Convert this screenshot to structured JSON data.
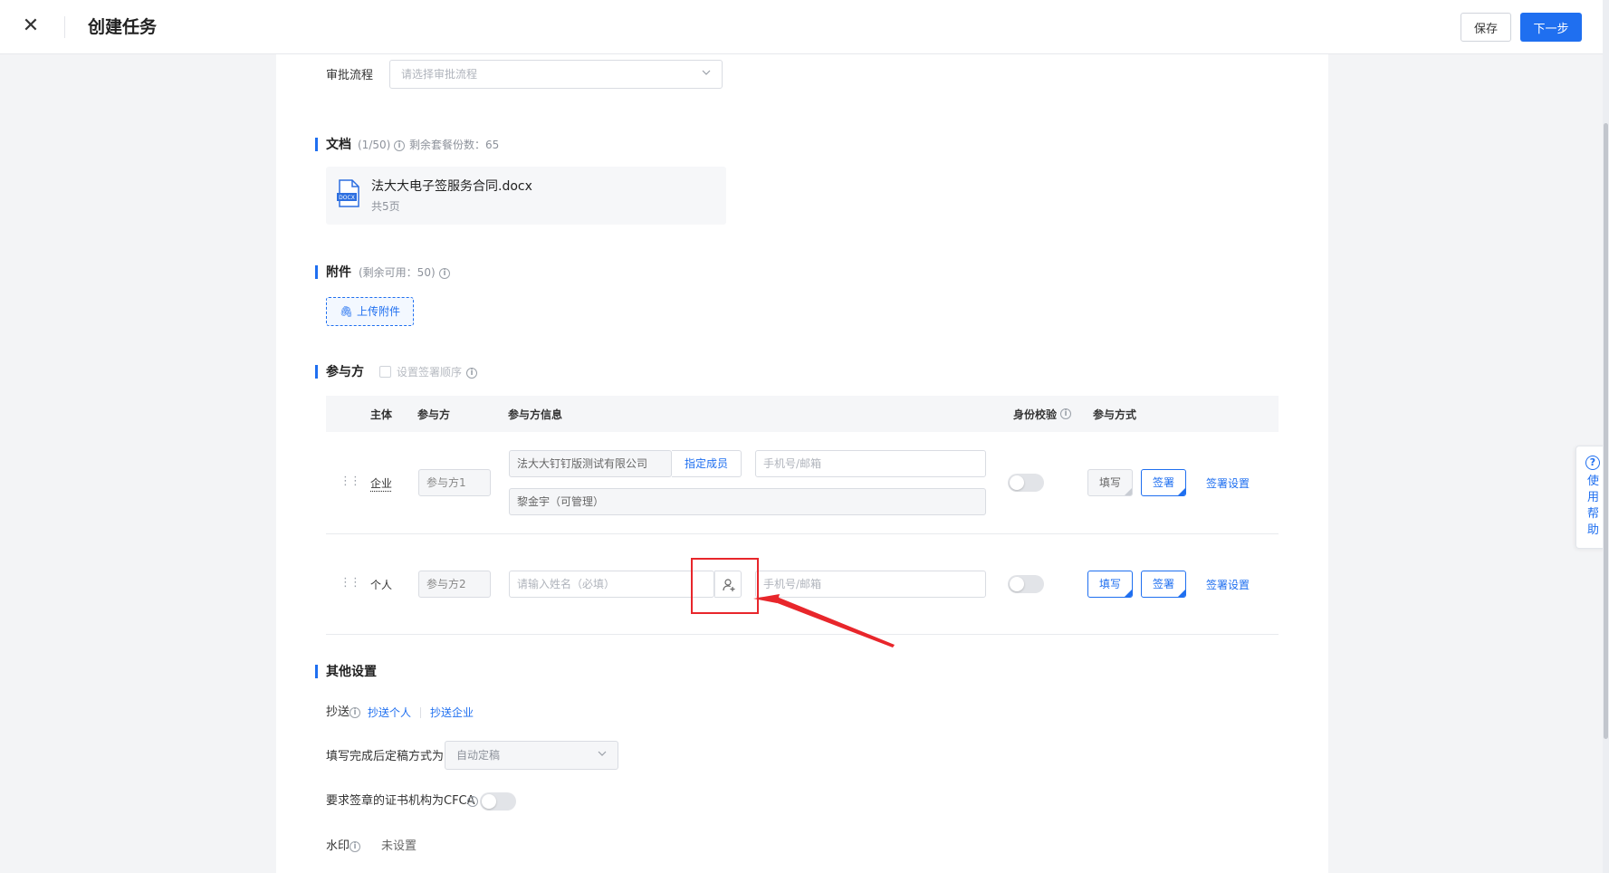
{
  "header": {
    "title": "创建任务",
    "save_label": "保存",
    "next_label": "下一步"
  },
  "approval": {
    "label": "审批流程",
    "placeholder": "请选择审批流程"
  },
  "documents": {
    "title": "文档",
    "count": "(1/50)",
    "remaining": "剩余套餐份数：65",
    "file_name": "法大大电子签服务合同.docx",
    "file_pages": "共5页",
    "file_icon_text": "DOCX"
  },
  "attachments": {
    "title": "附件",
    "available": "(剩余可用：50)",
    "upload_label": "上传附件"
  },
  "participants": {
    "title": "参与方",
    "order_label": "设置签署顺序",
    "columns": {
      "subject": "主体",
      "party": "参与方",
      "info": "参与方信息",
      "identity": "身份校验",
      "mode": "参与方式"
    },
    "rows": [
      {
        "subject": "企业",
        "party": "参与方1",
        "company": "法大大钉钉版测试有限公司",
        "assign_label": "指定成员",
        "contact_placeholder": "手机号/邮箱",
        "member": "黎金宇（可管理）",
        "fill_label": "填写",
        "sign_label": "签署",
        "settings_label": "签署设置"
      },
      {
        "subject": "个人",
        "party": "参与方2",
        "name_placeholder": "请输入姓名（必填）",
        "contact_placeholder": "手机号/邮箱",
        "fill_label": "填写",
        "sign_label": "签署",
        "settings_label": "签署设置"
      }
    ]
  },
  "other": {
    "title": "其他设置",
    "cc_label": "抄送",
    "cc_person": "抄送个人",
    "cc_company": "抄送企业",
    "finalize_label": "填写完成后定稿方式为",
    "finalize_value": "自动定稿",
    "cfca_label": "要求签章的证书机构为CFCA",
    "watermark_label": "水印",
    "watermark_value": "未设置"
  },
  "help": {
    "label": "使用帮助"
  },
  "colors": {
    "primary": "#1f6ff0",
    "annotation": "#e8262b"
  }
}
